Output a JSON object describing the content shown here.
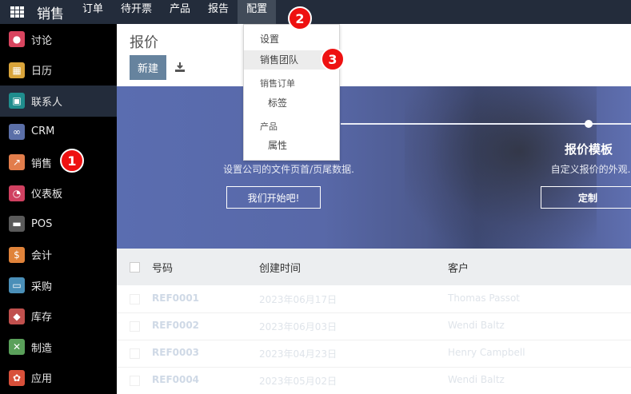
{
  "topbar": {
    "brand": "销售",
    "nav": [
      "订单",
      "待开票",
      "产品",
      "报告",
      "配置"
    ]
  },
  "sidebar": {
    "items": [
      {
        "label": "讨论",
        "icon": "chat-icon",
        "color": "#d9455f"
      },
      {
        "label": "日历",
        "icon": "calendar-icon",
        "color": "#d9a43a"
      },
      {
        "label": "联系人",
        "icon": "contacts-icon",
        "color": "#1f8d8d"
      },
      {
        "label": "CRM",
        "icon": "handshake-icon",
        "color": "#5b6fa8"
      },
      {
        "label": "销售",
        "icon": "chart-icon",
        "color": "#e27d4b"
      },
      {
        "label": "仪表板",
        "icon": "gauge-icon",
        "color": "#d04060"
      },
      {
        "label": "POS",
        "icon": "store-icon",
        "color": "#5a5a5a"
      },
      {
        "label": "会计",
        "icon": "invoice-icon",
        "color": "#e0833a"
      },
      {
        "label": "采购",
        "icon": "card-icon",
        "color": "#4a8fb8"
      },
      {
        "label": "库存",
        "icon": "boxes-icon",
        "color": "#c0504d"
      },
      {
        "label": "制造",
        "icon": "wrench-icon",
        "color": "#5aa05a"
      },
      {
        "label": "应用",
        "icon": "apps-cluster-icon",
        "color": "#d8503a"
      }
    ]
  },
  "main": {
    "title": "报价",
    "new_button": "新建"
  },
  "banner": {
    "step1_desc": "设置公司的文件页首/页尾数据.",
    "step1_button": "我们开始吧!",
    "step2_title": "报价模板",
    "step2_desc": "自定义报价的外观.",
    "step2_button": "定制"
  },
  "table": {
    "headers": [
      "号码",
      "创建时间",
      "客户"
    ],
    "rows": [
      {
        "ref": "REF0001",
        "date": "2023年06月17日",
        "customer": "Thomas Passot"
      },
      {
        "ref": "REF0002",
        "date": "2023年06月03日",
        "customer": "Wendi Baltz"
      },
      {
        "ref": "REF0003",
        "date": "2023年04月23日",
        "customer": "Henry Campbell"
      },
      {
        "ref": "REF0004",
        "date": "2023年05月02日",
        "customer": "Wendi Baltz"
      }
    ]
  },
  "config_menu": {
    "header1": "设置",
    "item1": "销售团队",
    "header2": "销售订单",
    "item2": "标签",
    "header3": "产品",
    "item3": "属性"
  },
  "markers": {
    "m1": "1",
    "m2": "2",
    "m3": "3"
  }
}
